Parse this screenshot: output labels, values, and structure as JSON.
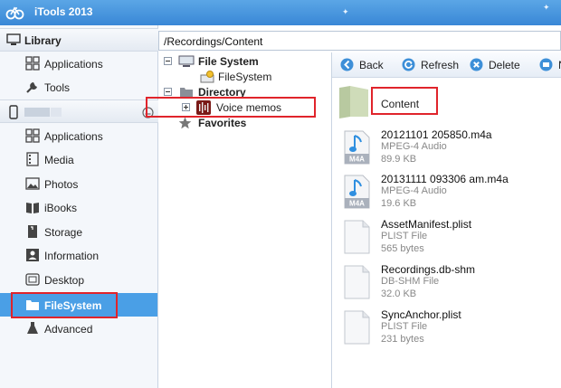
{
  "app": {
    "title": "iTools 2013"
  },
  "sidebar": {
    "library_header": "Library",
    "library_items": [
      {
        "label": "Applications",
        "icon": "apps-grid-icon"
      },
      {
        "label": "Tools",
        "icon": "wrench-icon"
      }
    ],
    "device_items": [
      {
        "label": "Applications",
        "icon": "apps-grid-icon"
      },
      {
        "label": "Media",
        "icon": "film-icon"
      },
      {
        "label": "Photos",
        "icon": "photo-icon"
      },
      {
        "label": "iBooks",
        "icon": "book-icon"
      },
      {
        "label": "Storage",
        "icon": "storage-icon"
      },
      {
        "label": "Information",
        "icon": "info-card-icon"
      },
      {
        "label": "Desktop",
        "icon": "desktop-icon"
      },
      {
        "label": "FileSystem",
        "icon": "folder-icon",
        "selected": true
      },
      {
        "label": "Advanced",
        "icon": "flask-icon"
      }
    ]
  },
  "path": "/Recordings/Content",
  "tree": {
    "file_system": "File System",
    "file_system_child": "FileSystem",
    "directory": "Directory",
    "voice_memos": "Voice memos",
    "favorites": "Favorites"
  },
  "toolbar": {
    "back": "Back",
    "refresh": "Refresh",
    "delete": "Delete",
    "more": "N"
  },
  "folder_label": "Content",
  "files": [
    {
      "name": "20121101 205850.m4a",
      "type": "MPEG-4 Audio",
      "size": "89.9 KB",
      "icon": "m4a"
    },
    {
      "name": "20131111 093306 am.m4a",
      "type": "MPEG-4 Audio",
      "size": "19.6 KB",
      "icon": "m4a"
    },
    {
      "name": "AssetManifest.plist",
      "type": "PLIST File",
      "size": "565 bytes",
      "icon": "doc"
    },
    {
      "name": "Recordings.db-shm",
      "type": "DB-SHM File",
      "size": "32.0 KB",
      "icon": "doc"
    },
    {
      "name": "SyncAnchor.plist",
      "type": "PLIST File",
      "size": "231 bytes",
      "icon": "doc"
    }
  ],
  "colors": {
    "titlebar": "#3f8fdb",
    "selected": "#4a9fe6",
    "annotation": "#e0242b"
  }
}
